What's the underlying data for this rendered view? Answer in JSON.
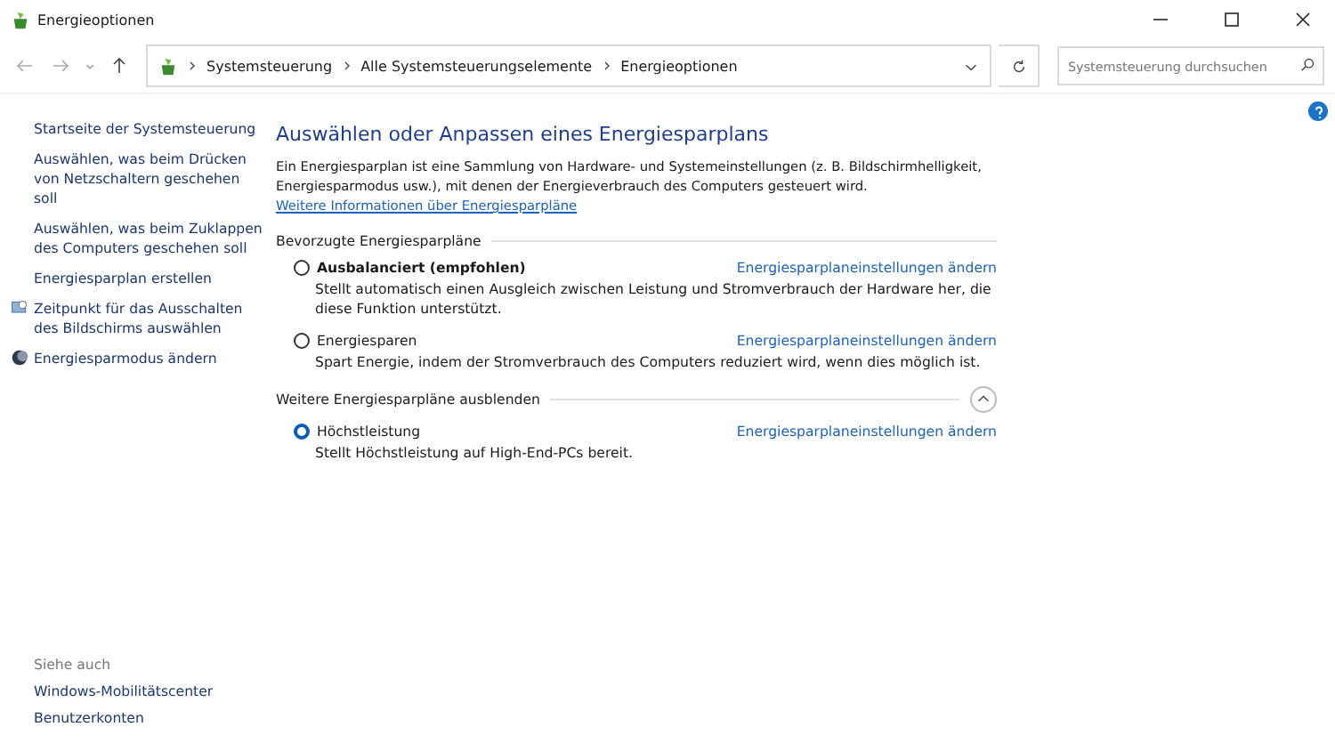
{
  "window": {
    "title": "Energieoptionen"
  },
  "address_bar": {
    "crumbs": [
      "Systemsteuerung",
      "Alle Systemsteuerungselemente",
      "Energieoptionen"
    ]
  },
  "search": {
    "placeholder": "Systemsteuerung durchsuchen"
  },
  "sidebar": {
    "items": [
      {
        "label": "Startseite der Systemsteuerung",
        "kind": "plain"
      },
      {
        "label": "Auswählen, was beim Drücken von Netzschaltern geschehen soll",
        "kind": "plain"
      },
      {
        "label": "Auswählen, was beim Zuklappen des Computers geschehen soll",
        "kind": "plain"
      },
      {
        "label": "Energiesparplan erstellen",
        "kind": "plain"
      },
      {
        "label": "Zeitpunkt für das Ausschalten des Bildschirms auswählen",
        "kind": "screen"
      },
      {
        "label": "Energiesparmodus ändern",
        "kind": "moon"
      }
    ],
    "see_also": {
      "heading": "Siehe auch",
      "items": [
        "Windows-Mobilitätscenter",
        "Benutzerkonten"
      ]
    }
  },
  "main": {
    "title": "Auswählen oder Anpassen eines Energiesparplans",
    "intro": "Ein Energiesparplan ist eine Sammlung von Hardware- und Systemeinstellungen (z. B. Bildschirmhelligkeit, Energiesparmodus usw.), mit denen der Energieverbrauch des Computers gesteuert wird.",
    "intro_link": "Weitere Informationen über Energiesparpläne",
    "sections": [
      {
        "heading": "Bevorzugte Energiesparpläne",
        "plans": [
          {
            "name": "Ausbalanciert (empfohlen)",
            "bold": true,
            "selected": false,
            "link": "Energiesparplaneinstellungen ändern",
            "description": "Stellt automatisch einen Ausgleich zwischen Leistung und Stromverbrauch der Hardware her, die diese Funktion unterstützt."
          },
          {
            "name": "Energiesparen",
            "bold": false,
            "selected": false,
            "link": "Energiesparplaneinstellungen ändern",
            "description": "Spart Energie, indem der Stromverbrauch des Computers reduziert wird, wenn dies möglich ist."
          }
        ]
      },
      {
        "heading": "Weitere Energiesparpläne ausblenden",
        "expanded": true,
        "plans": [
          {
            "name": "Höchstleistung",
            "bold": false,
            "selected": true,
            "link": "Energiesparplaneinstellungen ändern",
            "description": "Stellt Höchstleistung auf High-End-PCs bereit."
          }
        ]
      }
    ]
  }
}
